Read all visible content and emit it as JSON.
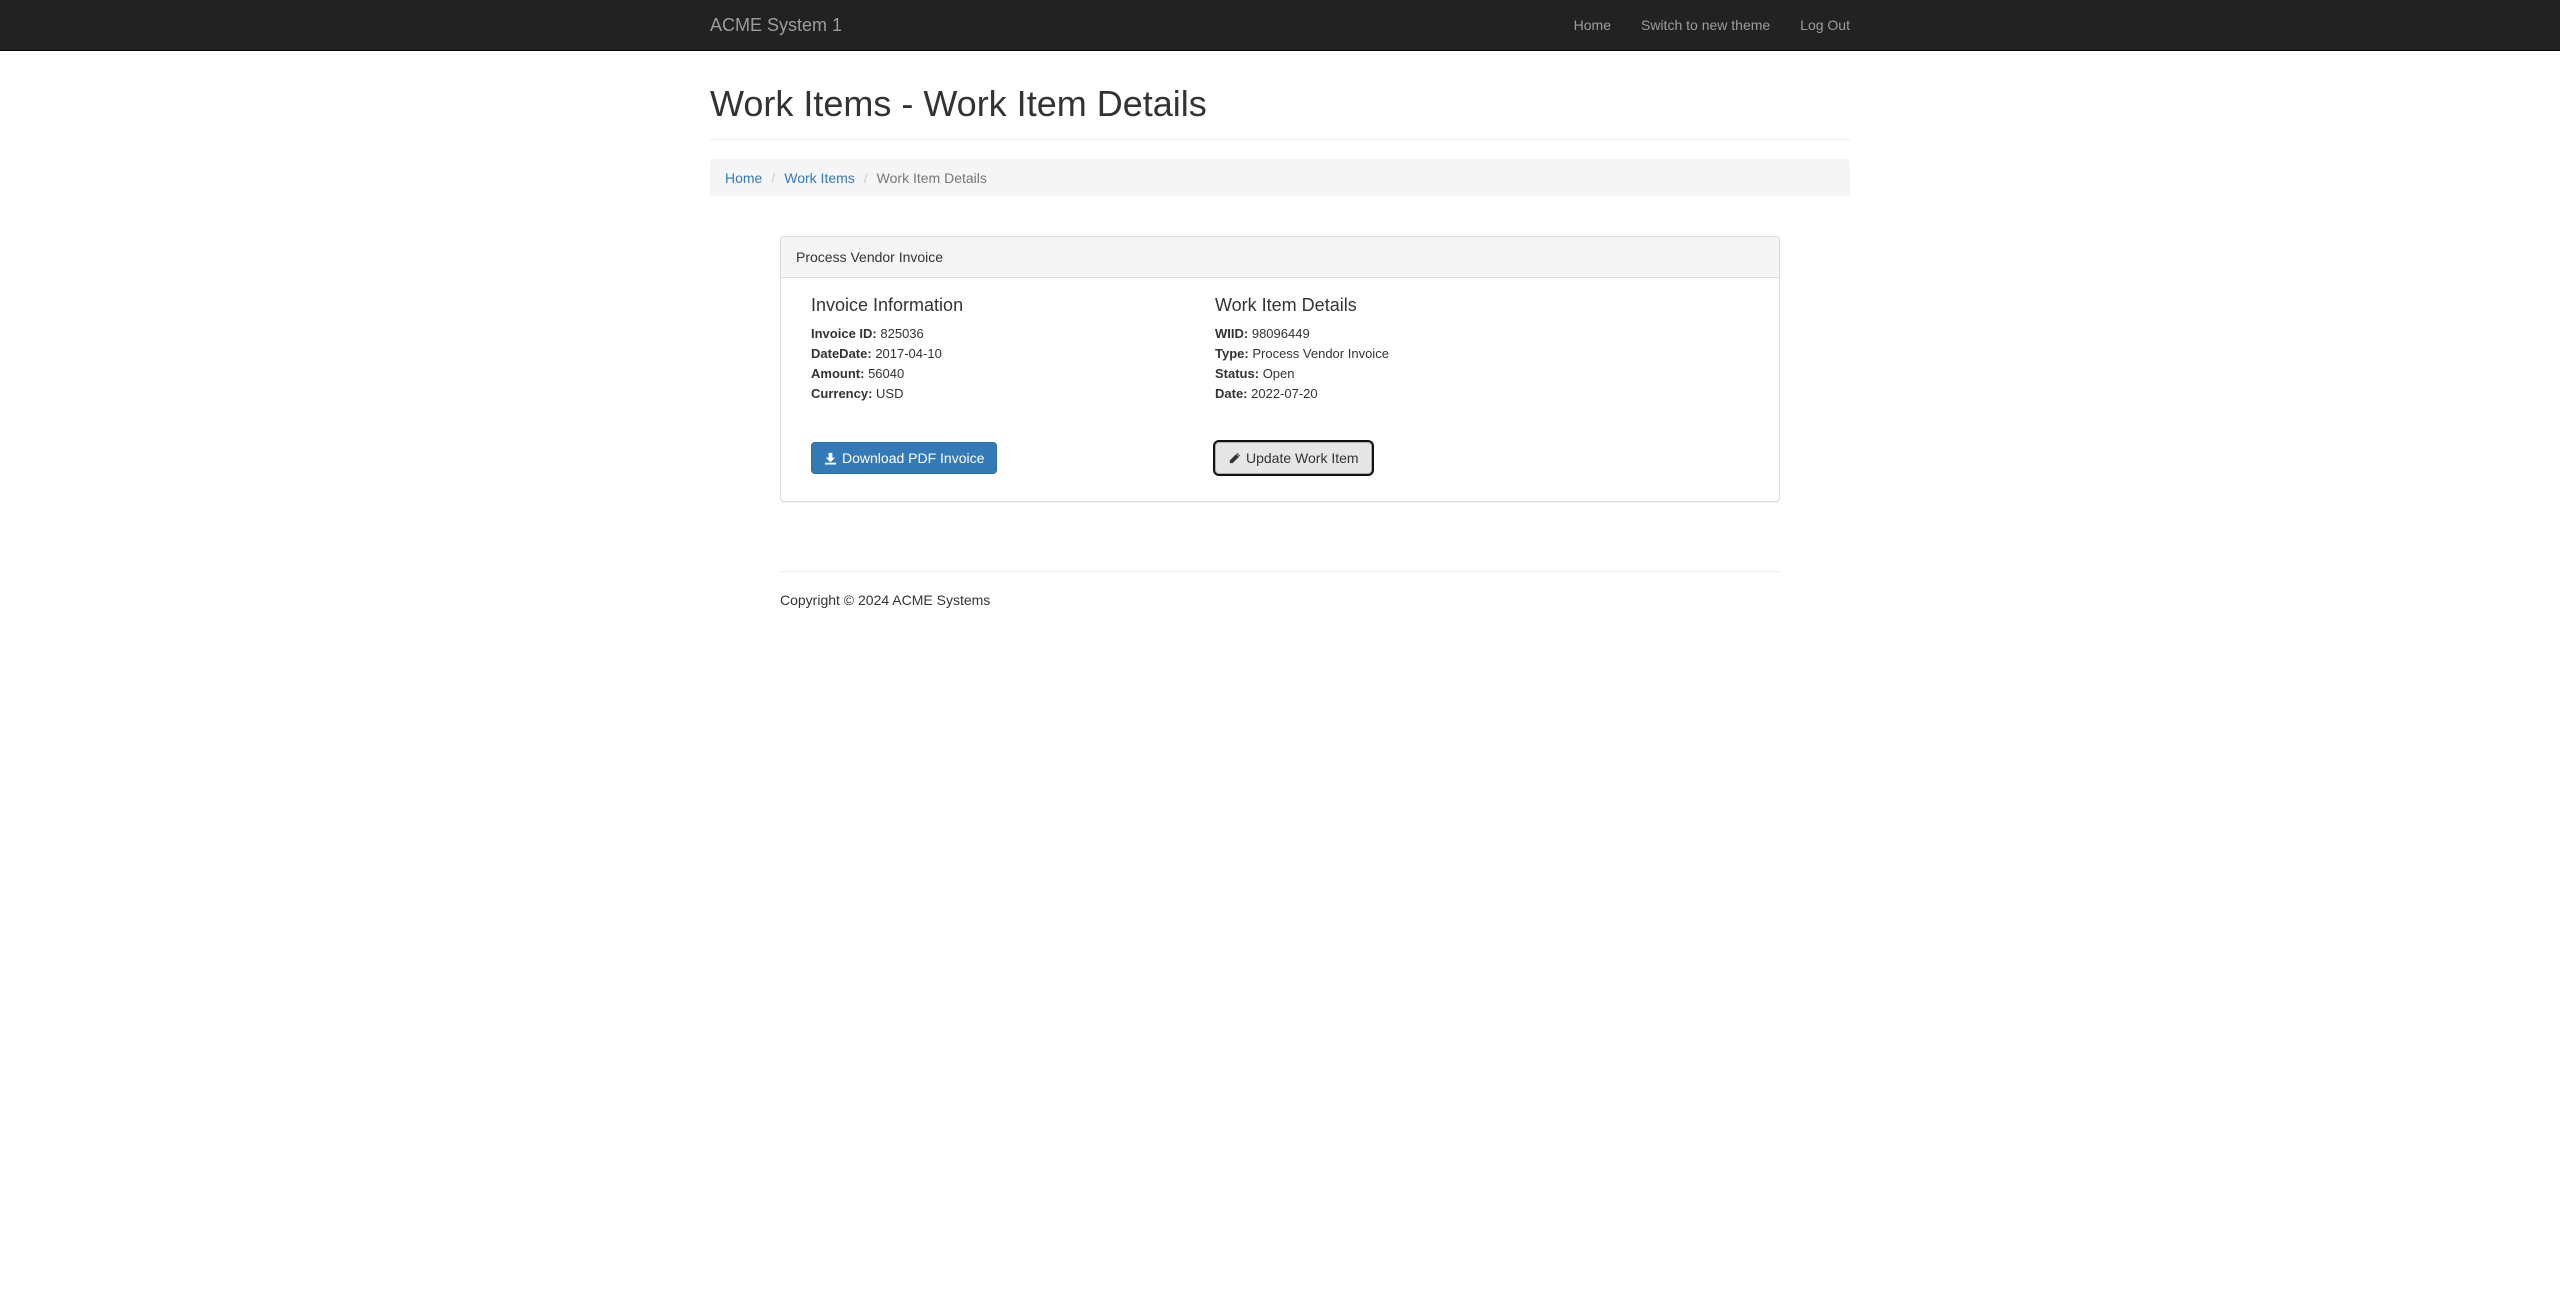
{
  "navbar": {
    "brand": "ACME System 1",
    "links": [
      "Home",
      "Switch to new theme",
      "Log Out"
    ]
  },
  "page": {
    "title": "Work Items - Work Item Details"
  },
  "breadcrumb": {
    "items": [
      "Home",
      "Work Items"
    ],
    "active": "Work Item Details",
    "separator": "/"
  },
  "panel": {
    "heading": "Process Vendor Invoice",
    "invoice": {
      "title": "Invoice Information",
      "fields": [
        {
          "label": "Invoice ID:",
          "value": "825036"
        },
        {
          "label": "DateDate:",
          "value": "2017-04-10"
        },
        {
          "label": "Amount:",
          "value": "56040"
        },
        {
          "label": "Currency:",
          "value": "USD"
        }
      ],
      "button": "Download PDF Invoice",
      "button_icon": "download-icon"
    },
    "work_item": {
      "title": "Work Item Details",
      "fields": [
        {
          "label": "WIID:",
          "value": "98096449"
        },
        {
          "label": "Type:",
          "value": "Process Vendor Invoice"
        },
        {
          "label": "Status:",
          "value": "Open"
        },
        {
          "label": "Date:",
          "value": "2022-07-20"
        }
      ],
      "button": "Update Work Item",
      "button_icon": "pencil-icon"
    }
  },
  "footer": {
    "copyright": "Copyright © 2024 ACME Systems"
  },
  "colors": {
    "navbar_bg": "#222222",
    "navbar_text": "#9d9d9d",
    "link": "#337ab7",
    "primary_button": "#337ab7"
  }
}
